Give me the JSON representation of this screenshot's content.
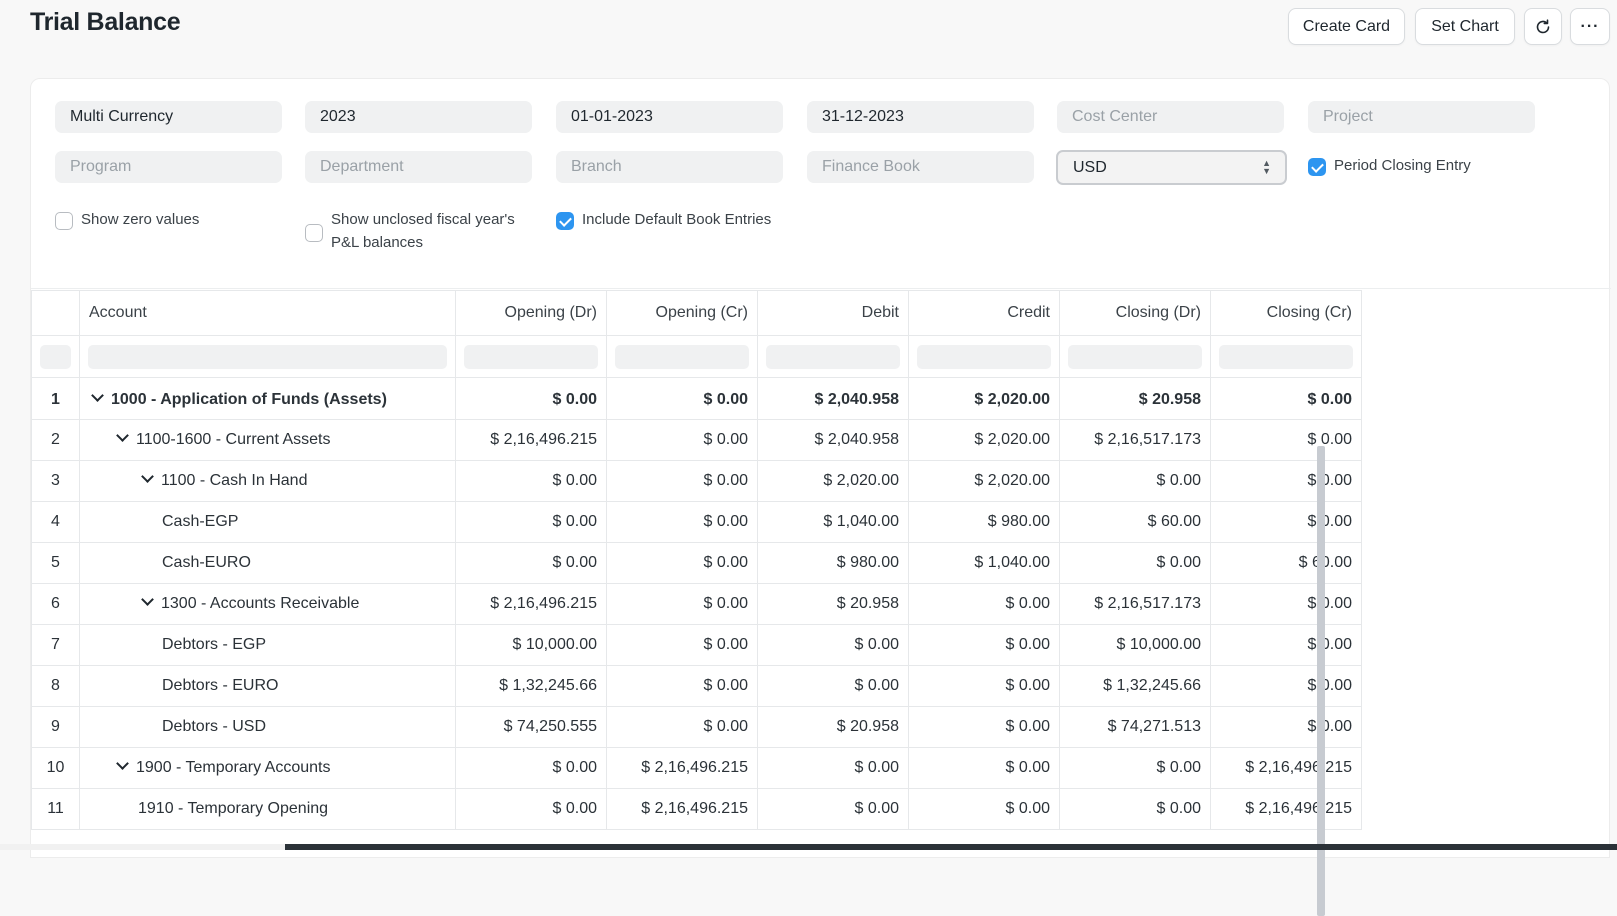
{
  "header": {
    "title": "Trial Balance",
    "create_card": "Create Card",
    "set_chart": "Set Chart",
    "refresh_icon": "refresh-icon",
    "more_label": "···"
  },
  "filters": {
    "company": "Multi Currency",
    "fiscal_year": "2023",
    "from_date": "01-01-2023",
    "to_date": "31-12-2023",
    "cost_center_placeholder": "Cost Center",
    "project_placeholder": "Project",
    "program_placeholder": "Program",
    "department_placeholder": "Department",
    "branch_placeholder": "Branch",
    "finance_book_placeholder": "Finance Book",
    "currency": "USD",
    "period_closing_entry": "Period Closing Entry",
    "period_closing_checked": true,
    "show_zero_values": "Show zero values",
    "show_zero_checked": false,
    "show_unclosed_line1": "Show unclosed fiscal year's",
    "show_unclosed_line2": "P&L balances",
    "show_unclosed_checked": false,
    "include_default_book": "Include Default Book Entries",
    "include_default_checked": true
  },
  "table": {
    "columns": [
      "Account",
      "Opening (Dr)",
      "Opening (Cr)",
      "Debit",
      "Credit",
      "Closing (Dr)",
      "Closing (Cr)"
    ],
    "rows": [
      {
        "idx": "1",
        "account": "1000 - Application of Funds (Assets)",
        "opening_dr": "$ 0.00",
        "opening_cr": "$ 0.00",
        "debit": "$ 2,040.958",
        "credit": "$ 2,020.00",
        "closing_dr": "$ 20.958",
        "closing_cr": "$ 0.00"
      },
      {
        "idx": "2",
        "account": "1100-1600 - Current Assets",
        "opening_dr": "$ 2,16,496.215",
        "opening_cr": "$ 0.00",
        "debit": "$ 2,040.958",
        "credit": "$ 2,020.00",
        "closing_dr": "$ 2,16,517.173",
        "closing_cr": "$ 0.00"
      },
      {
        "idx": "3",
        "account": "1100 - Cash In Hand",
        "opening_dr": "$ 0.00",
        "opening_cr": "$ 0.00",
        "debit": "$ 2,020.00",
        "credit": "$ 2,020.00",
        "closing_dr": "$ 0.00",
        "closing_cr": "$ 0.00"
      },
      {
        "idx": "4",
        "account": "Cash-EGP",
        "opening_dr": "$ 0.00",
        "opening_cr": "$ 0.00",
        "debit": "$ 1,040.00",
        "credit": "$ 980.00",
        "closing_dr": "$ 60.00",
        "closing_cr": "$ 0.00"
      },
      {
        "idx": "5",
        "account": "Cash-EURO",
        "opening_dr": "$ 0.00",
        "opening_cr": "$ 0.00",
        "debit": "$ 980.00",
        "credit": "$ 1,040.00",
        "closing_dr": "$ 0.00",
        "closing_cr": "$ 60.00"
      },
      {
        "idx": "6",
        "account": "1300 - Accounts Receivable",
        "opening_dr": "$ 2,16,496.215",
        "opening_cr": "$ 0.00",
        "debit": "$ 20.958",
        "credit": "$ 0.00",
        "closing_dr": "$ 2,16,517.173",
        "closing_cr": "$ 0.00"
      },
      {
        "idx": "7",
        "account": "Debtors - EGP",
        "opening_dr": "$ 10,000.00",
        "opening_cr": "$ 0.00",
        "debit": "$ 0.00",
        "credit": "$ 0.00",
        "closing_dr": "$ 10,000.00",
        "closing_cr": "$ 0.00"
      },
      {
        "idx": "8",
        "account": "Debtors - EURO",
        "opening_dr": "$ 1,32,245.66",
        "opening_cr": "$ 0.00",
        "debit": "$ 0.00",
        "credit": "$ 0.00",
        "closing_dr": "$ 1,32,245.66",
        "closing_cr": "$ 0.00"
      },
      {
        "idx": "9",
        "account": "Debtors - USD",
        "opening_dr": "$ 74,250.555",
        "opening_cr": "$ 0.00",
        "debit": "$ 20.958",
        "credit": "$ 0.00",
        "closing_dr": "$ 74,271.513",
        "closing_cr": "$ 0.00"
      },
      {
        "idx": "10",
        "account": "1900 - Temporary Accounts",
        "opening_dr": "$ 0.00",
        "opening_cr": "$ 2,16,496.215",
        "debit": "$ 0.00",
        "credit": "$ 0.00",
        "closing_dr": "$ 0.00",
        "closing_cr": "$ 2,16,496.215"
      },
      {
        "idx": "11",
        "account": "1910 - Temporary Opening",
        "opening_dr": "$ 0.00",
        "opening_cr": "$ 2,16,496.215",
        "debit": "$ 0.00",
        "credit": "$ 0.00",
        "closing_dr": "$ 0.00",
        "closing_cr": "$ 2,16,496.215"
      }
    ]
  }
}
